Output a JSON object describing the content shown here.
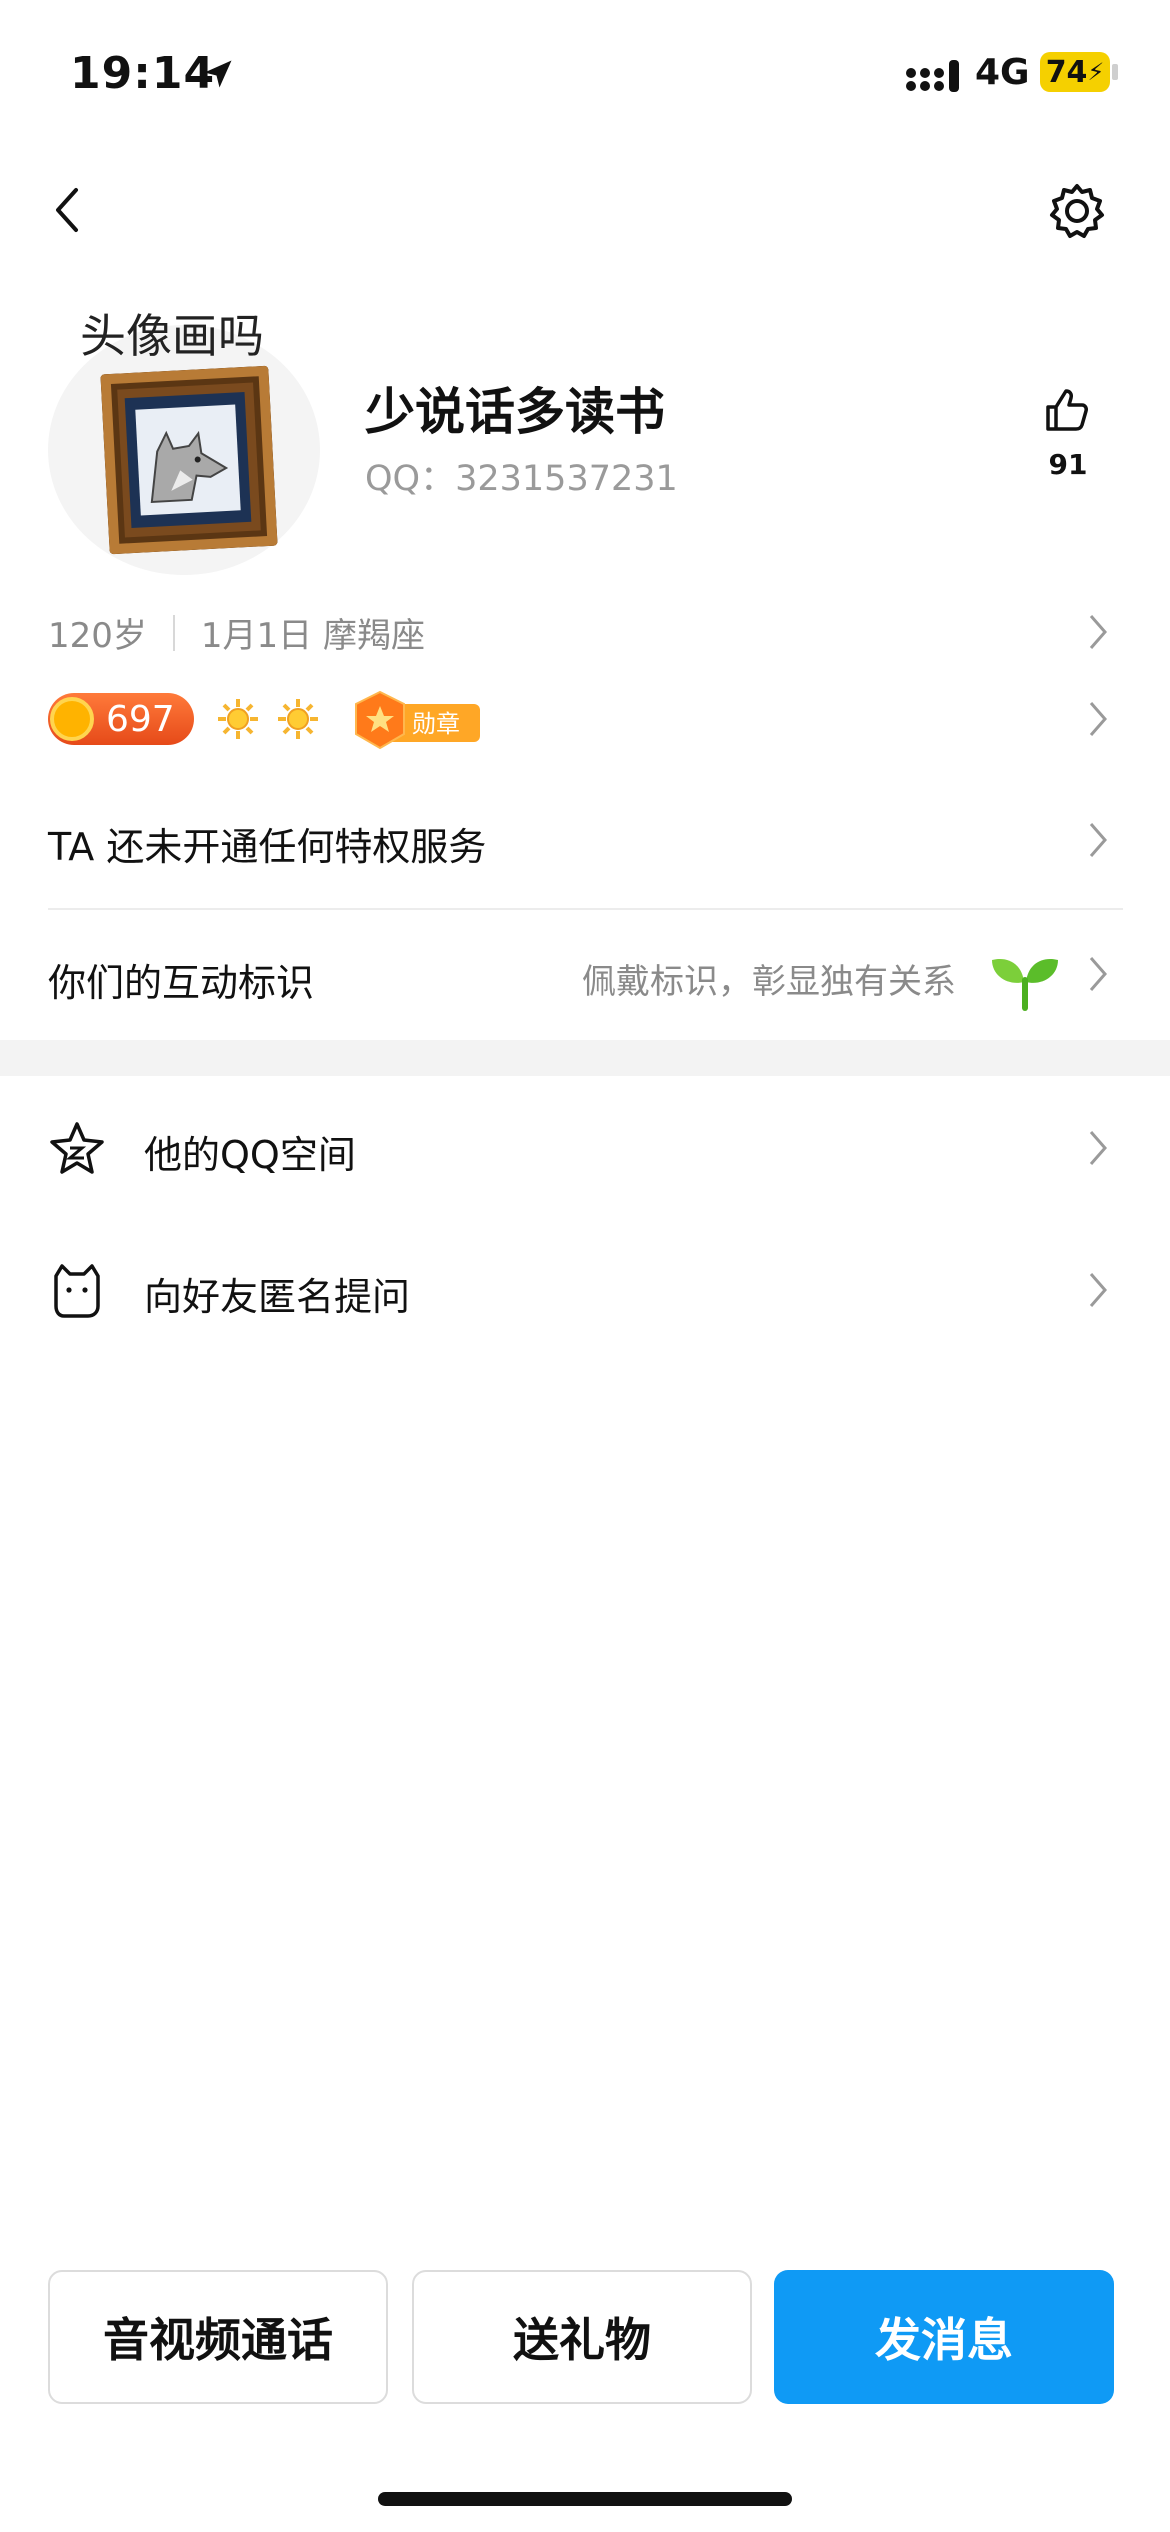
{
  "status_bar": {
    "time": "19:14",
    "network": "4G",
    "battery": "74"
  },
  "header": {
    "back_icon": "chevron-left-icon",
    "settings_icon": "gear-icon"
  },
  "profile": {
    "avatar_caption": "头像画吗",
    "nickname": "少说话多读书",
    "qq_label": "QQ：3231537231",
    "like_count": "91"
  },
  "info": {
    "age": "120岁",
    "birthday_sign": "1月1日  摩羯座"
  },
  "badges": {
    "coin_value": "697",
    "medal_label": "勋章"
  },
  "rows": {
    "privilege": "TA 还未开通任何特权服务",
    "interaction_title": "你们的互动标识",
    "interaction_hint": "佩戴标识，彰显独有关系"
  },
  "list": [
    {
      "label": "他的QQ空间",
      "icon": "star-space-icon"
    },
    {
      "label": "向好友匿名提问",
      "icon": "cat-ask-icon"
    }
  ],
  "actions": {
    "call": "音视频通话",
    "gift": "送礼物",
    "message": "发消息"
  },
  "colors": {
    "primary": "#0f9af5",
    "coin": "#e64a19",
    "medal": "#ff9800"
  }
}
